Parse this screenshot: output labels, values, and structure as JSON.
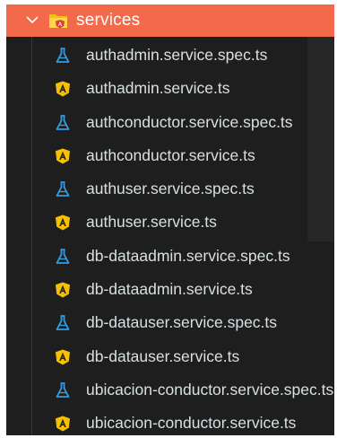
{
  "folder": {
    "name": "services",
    "icon": "angular-folder-icon",
    "expanded": true,
    "highlight_color": "#f26a4a"
  },
  "files": [
    {
      "name": "authadmin.service.spec.ts",
      "icon": "test-flask-icon"
    },
    {
      "name": "authadmin.service.ts",
      "icon": "angular-service-icon"
    },
    {
      "name": "authconductor.service.spec.ts",
      "icon": "test-flask-icon"
    },
    {
      "name": "authconductor.service.ts",
      "icon": "angular-service-icon"
    },
    {
      "name": "authuser.service.spec.ts",
      "icon": "test-flask-icon"
    },
    {
      "name": "authuser.service.ts",
      "icon": "angular-service-icon"
    },
    {
      "name": "db-dataadmin.service.spec.ts",
      "icon": "test-flask-icon"
    },
    {
      "name": "db-dataadmin.service.ts",
      "icon": "angular-service-icon"
    },
    {
      "name": "db-datauser.service.spec.ts",
      "icon": "test-flask-icon"
    },
    {
      "name": "db-datauser.service.ts",
      "icon": "angular-service-icon"
    },
    {
      "name": "ubicacion-conductor.service.spec.ts",
      "icon": "test-flask-icon"
    },
    {
      "name": "ubicacion-conductor.service.ts",
      "icon": "angular-service-icon"
    }
  ],
  "colors": {
    "background": "#1e1e1e",
    "text": "#d7e0e3",
    "test_icon": "#2f9fe0",
    "angular_icon": "#f5c000"
  }
}
